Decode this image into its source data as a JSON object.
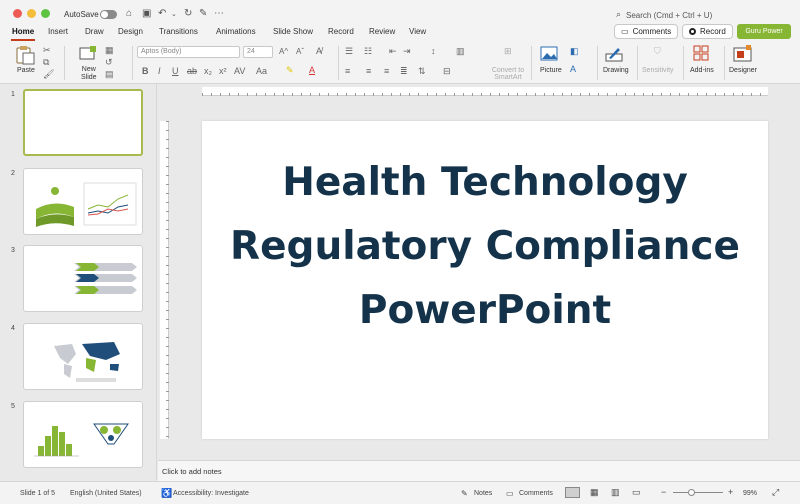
{
  "titlebar": {
    "autosave": "AutoSave",
    "search": "Search (Cmd + Ctrl + U)",
    "colors": {
      "close": "#ee5b54",
      "min": "#f4bd3b",
      "max": "#5dc343"
    }
  },
  "tabs": [
    "Home",
    "Insert",
    "Draw",
    "Design",
    "Transitions",
    "Animations",
    "Slide Show",
    "Record",
    "Review",
    "View"
  ],
  "top_buttons": {
    "comments": "Comments",
    "record": "Record",
    "guru": "Guru Power"
  },
  "ribbon": {
    "paste": "Paste",
    "new_slide": "New\nSlide",
    "font_name": "Aptos (Body)",
    "font_size": "24",
    "convert": "Convert to SmartArt",
    "picture": "Picture",
    "drawing": "Drawing",
    "sensitivity": "Sensitivity",
    "addins": "Add-ins",
    "designer": "Designer"
  },
  "slides": [
    {
      "num": "1"
    },
    {
      "num": "2"
    },
    {
      "num": "3"
    },
    {
      "num": "4"
    },
    {
      "num": "5"
    }
  ],
  "slide": {
    "title": "Health Technology Regulatory Compliance PowerPoint"
  },
  "notes": {
    "placeholder": "Click to add notes"
  },
  "status": {
    "slide_of": "Slide 1 of 5",
    "language": "English (United States)",
    "accessibility": "Accessibility: Investigate",
    "notes": "Notes",
    "comments": "Comments",
    "zoom": "99%"
  },
  "theme": {
    "accent": "#c43e1c",
    "title_color": "#14334a",
    "green": "#87b534",
    "blue": "#1e4e79",
    "grey": "#c8ccd2"
  }
}
